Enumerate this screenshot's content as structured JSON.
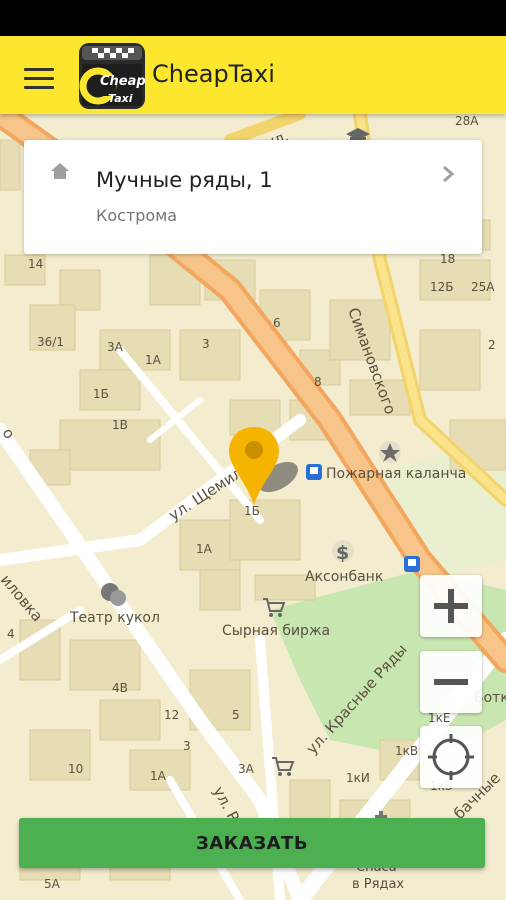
{
  "app": {
    "title": "CheapTaxi",
    "logo_text_top": "Cheap",
    "logo_text_bottom": "Taxi"
  },
  "address": {
    "street": "Мучные ряды, 1",
    "city": "Кострома"
  },
  "order_button": {
    "label": "ЗАКАЗАТЬ"
  },
  "map": {
    "streets": {
      "shchemilovka": "ул. Щемиловка",
      "simanovskogo": "Симановского",
      "krasnye_ryady": "ул. Красные Ряды",
      "ryb": "ул. Ры",
      "ilovka": "иловка",
      "o": "о",
      "ul_top": "ул.",
      "bachnye": "бачные",
      "botk": "Ботк"
    },
    "pois": {
      "pozharnaya": "Пожарная каланча",
      "aksonbank": "Аксонбанк",
      "teatr": "Театр кукол",
      "syrnaya": "Сырная биржа",
      "spasa": "Спаса",
      "v_ryadah": "в Рядах"
    },
    "house_numbers": {
      "h28a": "28А",
      "h12b": "12Б",
      "h14": "14",
      "h18": "18",
      "h25a": "25А",
      "h2": "2",
      "h36_1": "36/1",
      "h3a": "3А",
      "h1a_a": "1А",
      "h1b_a": "1Б",
      "h1v": "1В",
      "h6": "6",
      "h3": "3",
      "h8": "8",
      "h1b_b": "1Б",
      "h1a_b": "1А",
      "h4": "4",
      "h4v": "4В",
      "h12": "12",
      "h5": "5",
      "h1ke": "1кЕ",
      "h1kv": "1кВ",
      "h1ki": "1кИ",
      "h1kz": "1кЗ",
      "h3a_b": "3А",
      "h10": "10",
      "h5a": "5А",
      "h1b_top": "1Б",
      "h3_top": "3",
      "h1a_top": "1А"
    }
  },
  "colors": {
    "app_bar": "#fde72e",
    "order_button": "#4caf50",
    "pin": "#f4b400",
    "map_bg": "#f3eccf",
    "main_road": "#f2a65e",
    "road": "#ffffff",
    "park": "#c8e6b0"
  },
  "icons": {
    "menu": "menu-icon",
    "home": "home-icon",
    "chevron": "chevron-right-icon",
    "zoom_in": "plus-icon",
    "zoom_out": "minus-icon",
    "locate": "crosshair-icon",
    "pin": "location-pin-icon",
    "bus": "bus-stop-icon",
    "bank": "dollar-icon",
    "shop": "cart-icon",
    "theater": "theater-masks-icon",
    "star": "star-icon",
    "school": "school-icon"
  }
}
